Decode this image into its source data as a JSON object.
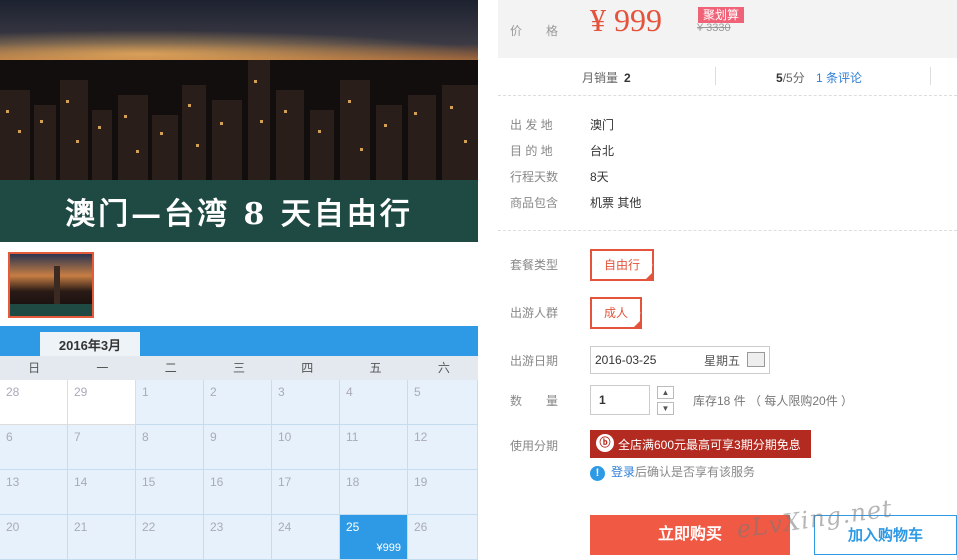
{
  "hero": {
    "banner_text": "澳门—台湾 8 天自由行"
  },
  "calendar": {
    "month": "2016年3月",
    "weekdays": [
      "日",
      "一",
      "二",
      "三",
      "四",
      "五",
      "六"
    ],
    "rows": [
      [
        "28",
        "29",
        "1",
        "2",
        "3",
        "4",
        "5"
      ],
      [
        "6",
        "7",
        "8",
        "9",
        "10",
        "11",
        "12"
      ],
      [
        "13",
        "14",
        "15",
        "16",
        "17",
        "18",
        "19"
      ],
      [
        "20",
        "21",
        "22",
        "23",
        "24",
        "25",
        "26"
      ]
    ],
    "selected_price": "¥999"
  },
  "product": {
    "price_label": "价　　格",
    "price": "¥ 999",
    "badge": "聚划算",
    "old_price": "¥ 3330",
    "monthly_sales_label": "月销量",
    "monthly_sales": "2",
    "rating": "5",
    "rating_suffix": "/5分",
    "reviews": "1 条评论"
  },
  "details": [
    {
      "label": "出 发 地",
      "value": "澳门"
    },
    {
      "label": "目 的 地",
      "value": "台北"
    },
    {
      "label": "行程天数",
      "value": "8天"
    },
    {
      "label": "商品包含",
      "value": "机票  其他"
    }
  ],
  "options": {
    "package_label": "套餐类型",
    "package_value": "自由行",
    "crowd_label": "出游人群",
    "crowd_value": "成人",
    "date_label": "出游日期",
    "date_value": "2016-03-25",
    "weekday_value": "星期五",
    "qty_label": "数　　量",
    "qty_value": "1",
    "stock_text": "库存18 件 （ 每人限购20件 ）",
    "installment_label": "使用分期",
    "promo_text": "全店满600元最高可享3期分期免息",
    "notice_link": "登录",
    "notice_text": "后确认是否享有该服务"
  },
  "actions": {
    "buy": "立即购买",
    "cart": "加入购物车"
  },
  "watermark": "eLvXing.net"
}
